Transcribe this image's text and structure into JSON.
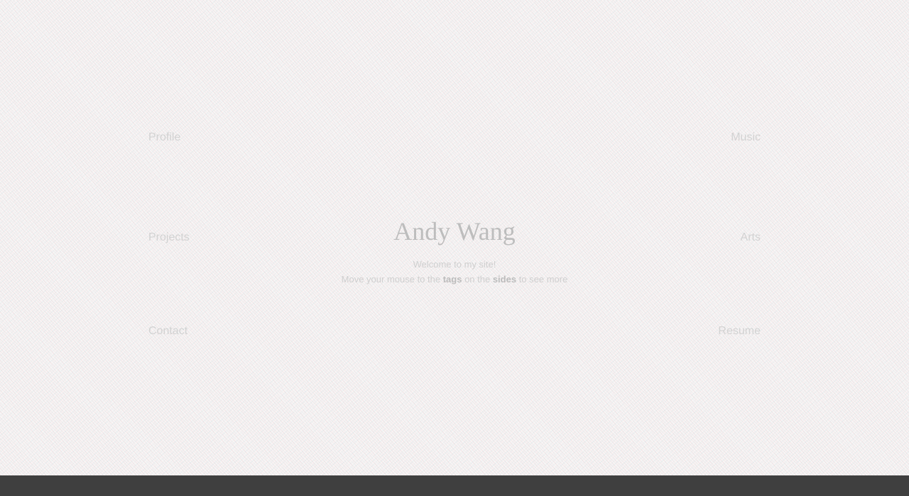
{
  "site": {
    "title": "Andy Wang",
    "welcome": "Welcome to my site!",
    "hint": {
      "prefix": "Move your mouse to the ",
      "emphasis1": "tags",
      "middle": " on the ",
      "emphasis2": "sides",
      "suffix": " to see more"
    }
  },
  "nav": {
    "left": [
      "Profile",
      "Projects",
      "Contact"
    ],
    "right": [
      "Music",
      "Arts",
      "Resume"
    ]
  },
  "colors": {
    "tag_text": "#d2d2d2",
    "title_text": "#bdbdbd",
    "footer_bar": "#3f3f3f",
    "background": "#f7f6f6"
  }
}
